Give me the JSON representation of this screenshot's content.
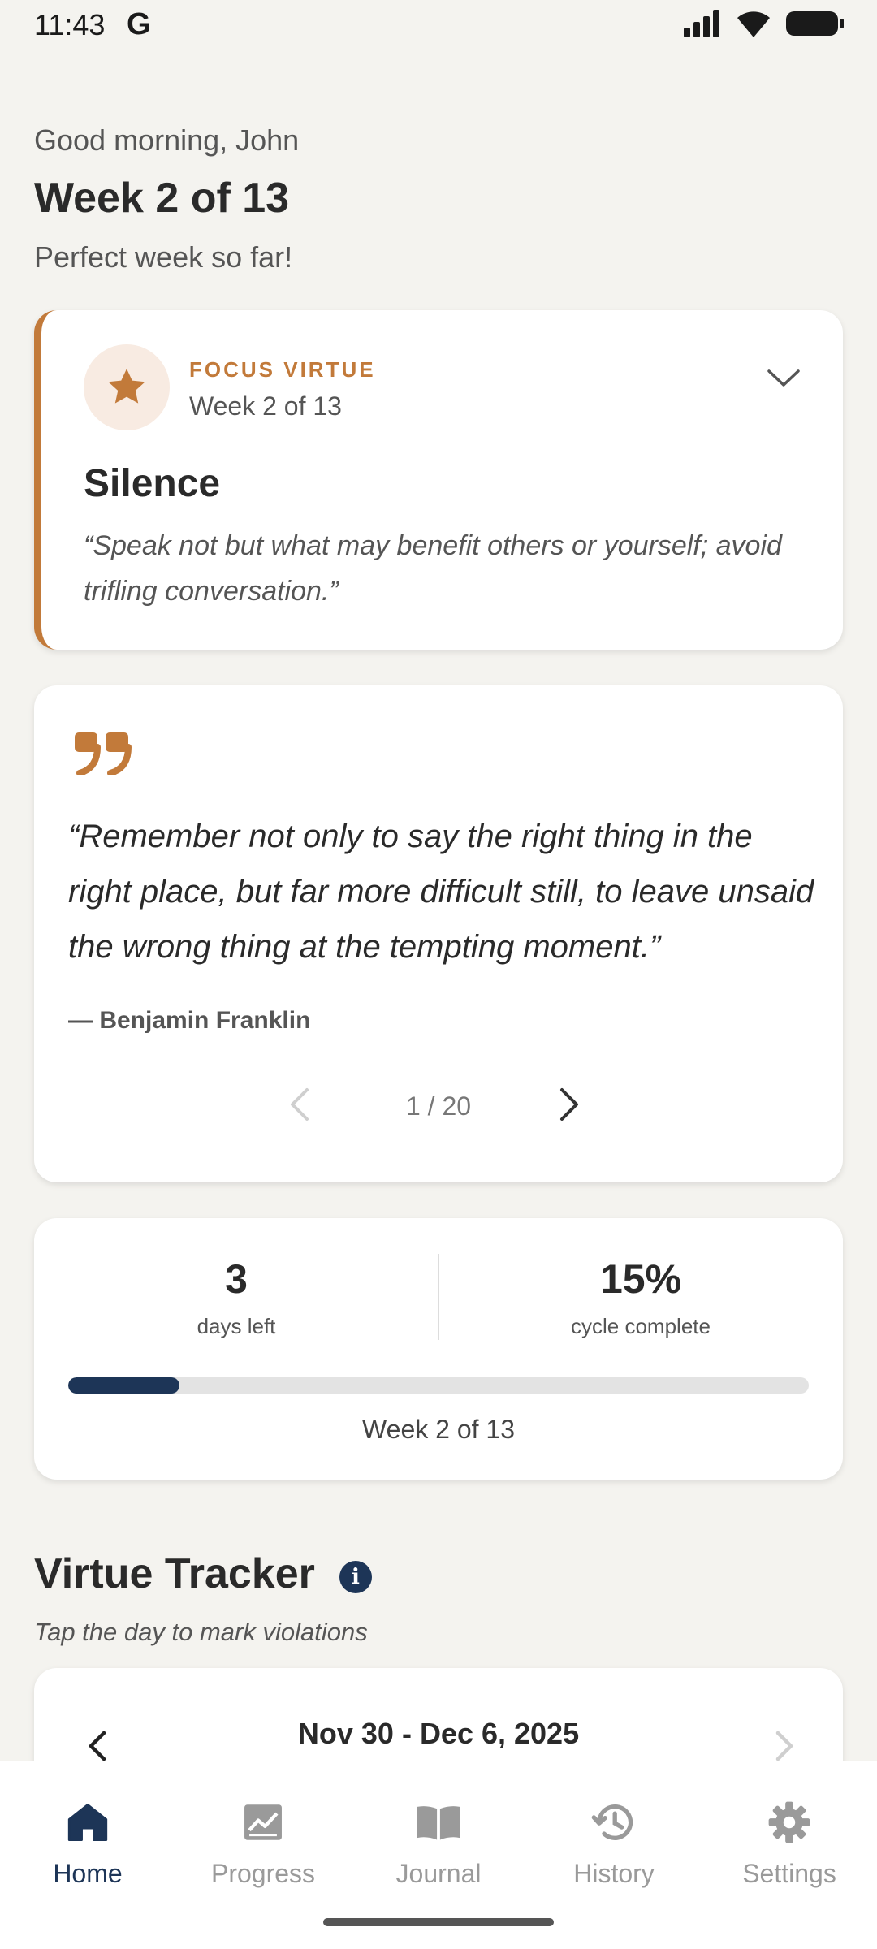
{
  "status_bar": {
    "time": "11:43",
    "app_glyph": "G"
  },
  "greeting": {
    "salutation": "Good morning, John",
    "week": "Week 2 of 13",
    "summary": "Perfect week so far!"
  },
  "focus_virtue": {
    "label": "FOCUS VIRTUE",
    "week": "Week 2 of 13",
    "name": "Silence",
    "precept": "“Speak not but what may benefit others or yourself; avoid trifling conversation.”",
    "accent_color": "#c27a3a"
  },
  "quote": {
    "text": "“Remember not only to say the right thing in the right place, but far more difficult still, to leave unsaid the wrong thing at the tempting moment.”",
    "author": "— Benjamin Franklin",
    "counter": "1 / 20"
  },
  "stats": {
    "days_left_value": "3",
    "days_left_label": "days left",
    "cycle_value": "15%",
    "cycle_label": "cycle complete",
    "progress_fraction": 0.15,
    "progress_color": "#1d3557",
    "week": "Week 2 of 13"
  },
  "tracker": {
    "title": "Virtue Tracker",
    "info_glyph": "i",
    "hint": "Tap the day to mark violations",
    "range": "Nov 30 - Dec 6, 2025"
  },
  "nav": {
    "items": [
      {
        "label": "Home",
        "icon": "home-icon",
        "active": true
      },
      {
        "label": "Progress",
        "icon": "chart-icon",
        "active": false
      },
      {
        "label": "Journal",
        "icon": "book-icon",
        "active": false
      },
      {
        "label": "History",
        "icon": "history-icon",
        "active": false
      },
      {
        "label": "Settings",
        "icon": "gear-icon",
        "active": false
      }
    ],
    "active_color": "#1d3557",
    "inactive_color": "#9a9a9a"
  }
}
